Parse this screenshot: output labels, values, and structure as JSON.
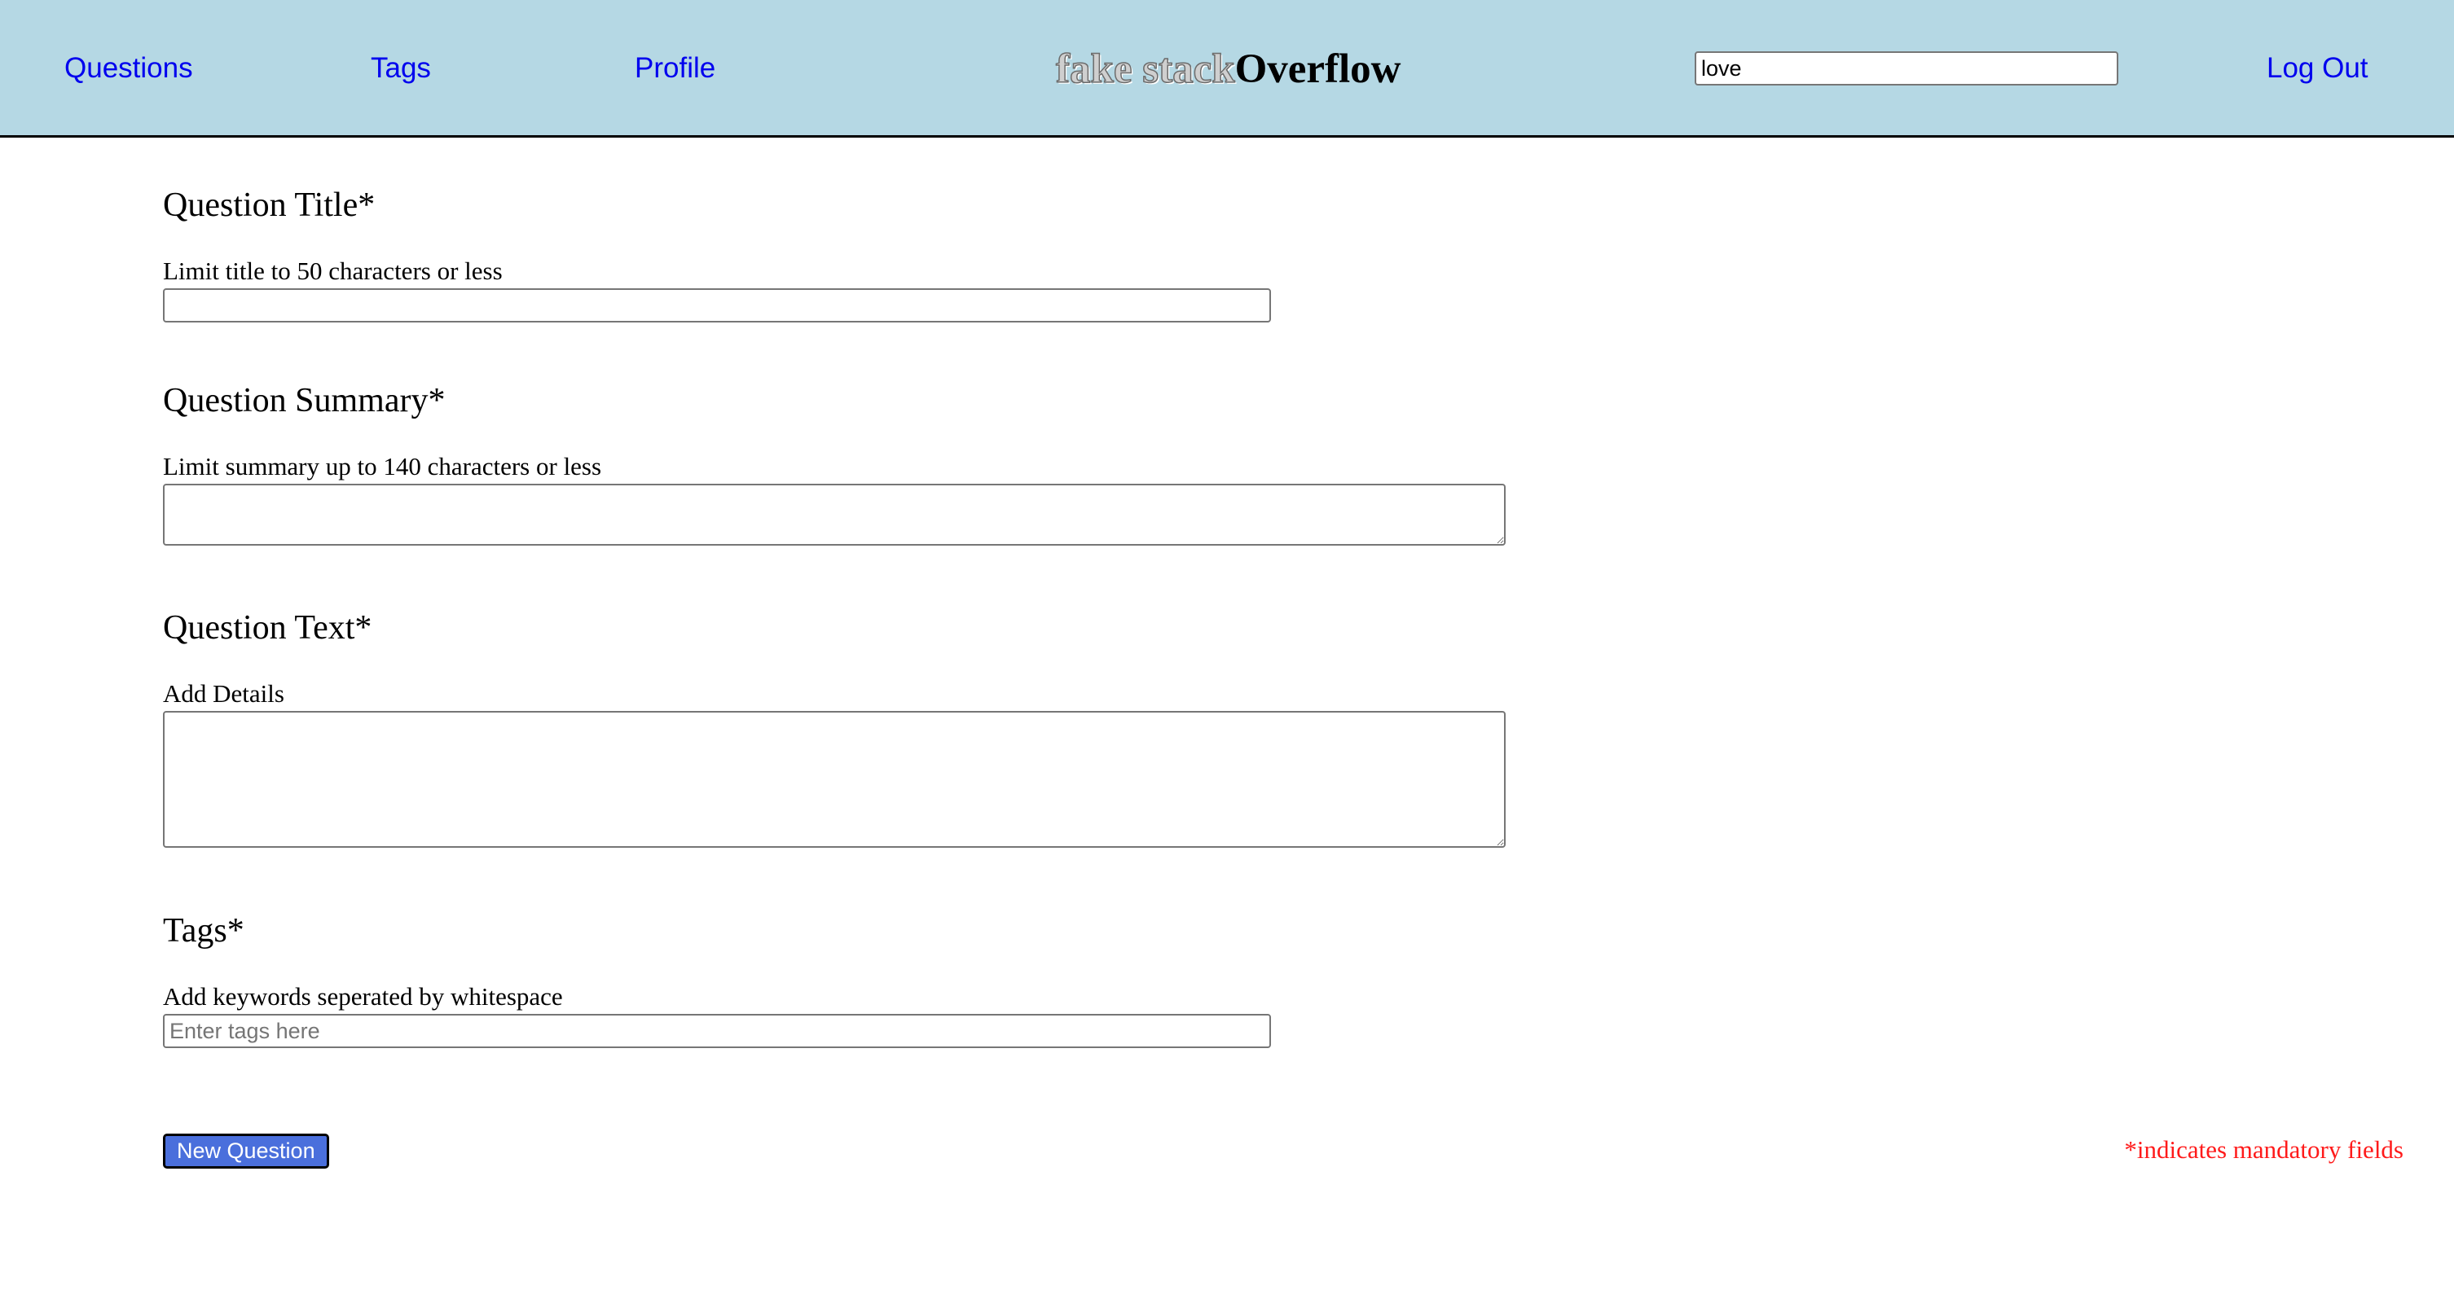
{
  "header": {
    "nav": {
      "questions": "Questions",
      "tags": "Tags",
      "profile": "Profile",
      "logout": "Log Out"
    },
    "logo": {
      "prefix": "fake stack",
      "main": "Overflow"
    },
    "search": {
      "value": "love"
    }
  },
  "form": {
    "title": {
      "heading": "Question Title*",
      "hint": "Limit title to 50 characters or less",
      "value": ""
    },
    "summary": {
      "heading": "Question Summary*",
      "hint": "Limit summary up to 140 characters or less",
      "value": ""
    },
    "text": {
      "heading": "Question Text*",
      "hint": "Add Details",
      "value": ""
    },
    "tags": {
      "heading": "Tags*",
      "hint": "Add keywords seperated by whitespace",
      "placeholder": "Enter tags here",
      "value": ""
    },
    "submit_label": "New Question",
    "mandatory_note": "*indicates mandatory fields"
  },
  "colors": {
    "header_background": "#b5d8e4",
    "link": "#0000ee",
    "button_background": "#4a6fdc",
    "mandatory_note": "#ff1a1a"
  }
}
